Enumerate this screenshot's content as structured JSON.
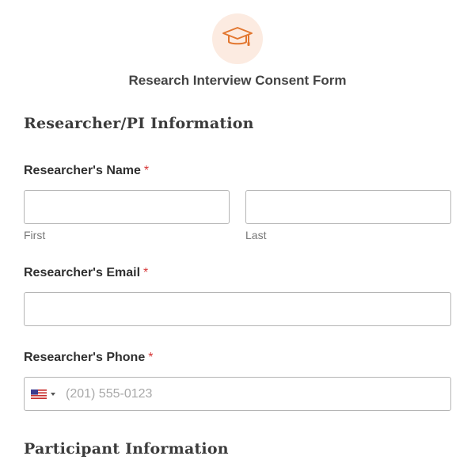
{
  "header": {
    "logo_icon": "graduation-cap-icon",
    "title": "Research Interview Consent Form",
    "accent_color": "#e27730"
  },
  "sections": {
    "researcher": {
      "title": "Researcher/PI Information"
    },
    "participant": {
      "title": "Participant Information"
    }
  },
  "fields": {
    "name": {
      "label": "Researcher's Name",
      "required_mark": "*",
      "first": {
        "value": "",
        "sublabel": "First"
      },
      "last": {
        "value": "",
        "sublabel": "Last"
      }
    },
    "email": {
      "label": "Researcher's Email",
      "required_mark": "*",
      "value": ""
    },
    "phone": {
      "label": "Researcher's Phone",
      "required_mark": "*",
      "country_icon": "us-flag-icon",
      "placeholder": "(201) 555-0123",
      "value": ""
    }
  }
}
